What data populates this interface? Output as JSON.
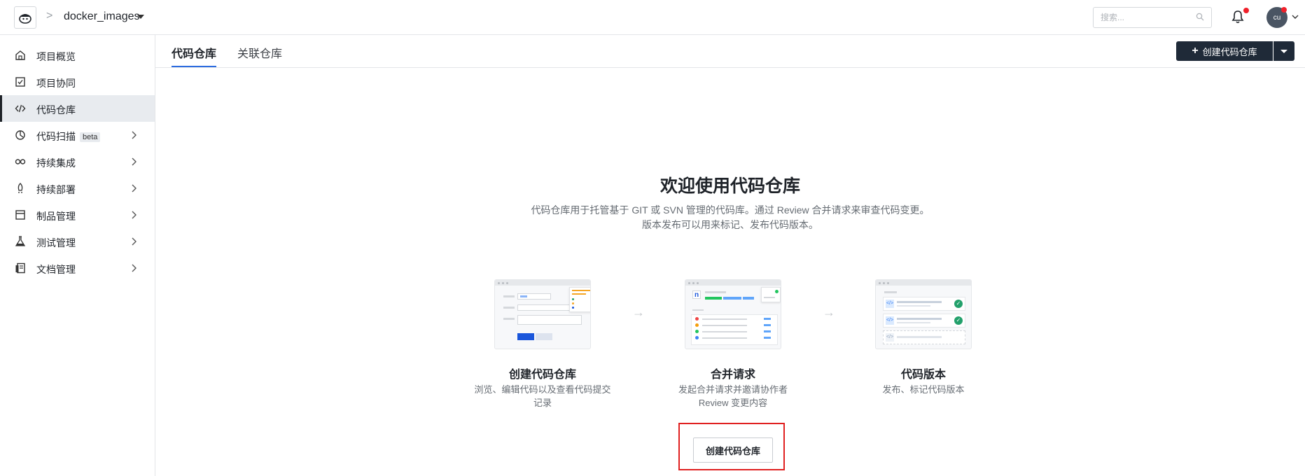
{
  "header": {
    "project_name": "docker_images",
    "breadcrumb_separator": ">",
    "search_placeholder": "搜索...",
    "avatar_initials": "cu"
  },
  "sidebar": {
    "items": [
      {
        "label": "项目概览",
        "icon": "home-icon",
        "active": false,
        "expandable": false
      },
      {
        "label": "项目协同",
        "icon": "checkbox-icon",
        "active": false,
        "expandable": false
      },
      {
        "label": "代码仓库",
        "icon": "code-icon",
        "active": true,
        "expandable": false
      },
      {
        "label": "代码扫描",
        "badge": "beta",
        "icon": "scan-icon",
        "active": false,
        "expandable": true
      },
      {
        "label": "持续集成",
        "icon": "infinity-icon",
        "active": false,
        "expandable": true
      },
      {
        "label": "持续部署",
        "icon": "rocket-icon",
        "active": false,
        "expandable": true
      },
      {
        "label": "制品管理",
        "icon": "package-icon",
        "active": false,
        "expandable": true
      },
      {
        "label": "测试管理",
        "icon": "flask-icon",
        "active": false,
        "expandable": true
      },
      {
        "label": "文档管理",
        "icon": "document-icon",
        "active": false,
        "expandable": true
      }
    ]
  },
  "tabs": [
    {
      "label": "代码仓库",
      "active": true
    },
    {
      "label": "关联仓库",
      "active": false
    }
  ],
  "toolbar": {
    "create_label": "创建代码仓库"
  },
  "welcome": {
    "title": "欢迎使用代码仓库",
    "desc_line1": "代码仓库用于托管基于 GIT 或 SVN 管理的代码库。通过 Review 合并请求来审查代码变更。",
    "desc_line2": "版本发布可以用来标记、发布代码版本。",
    "features": [
      {
        "title": "创建代码仓库",
        "desc_line1": "浏览、编辑代码以及查看代码提交",
        "desc_line2": "记录"
      },
      {
        "title": "合并请求",
        "desc_line1": "发起合并请求并邀请协作者",
        "desc_line2": "Review 变更内容"
      },
      {
        "title": "代码版本",
        "desc_line1": "发布、标记代码版本",
        "desc_line2": ""
      }
    ],
    "arrow": "→",
    "cta_label": "创建代码仓库"
  },
  "colors": {
    "primary_dark": "#1f2a38",
    "accent_blue": "#2d6cdf",
    "highlight_red": "#e02020",
    "notification_red": "#f0202a"
  }
}
